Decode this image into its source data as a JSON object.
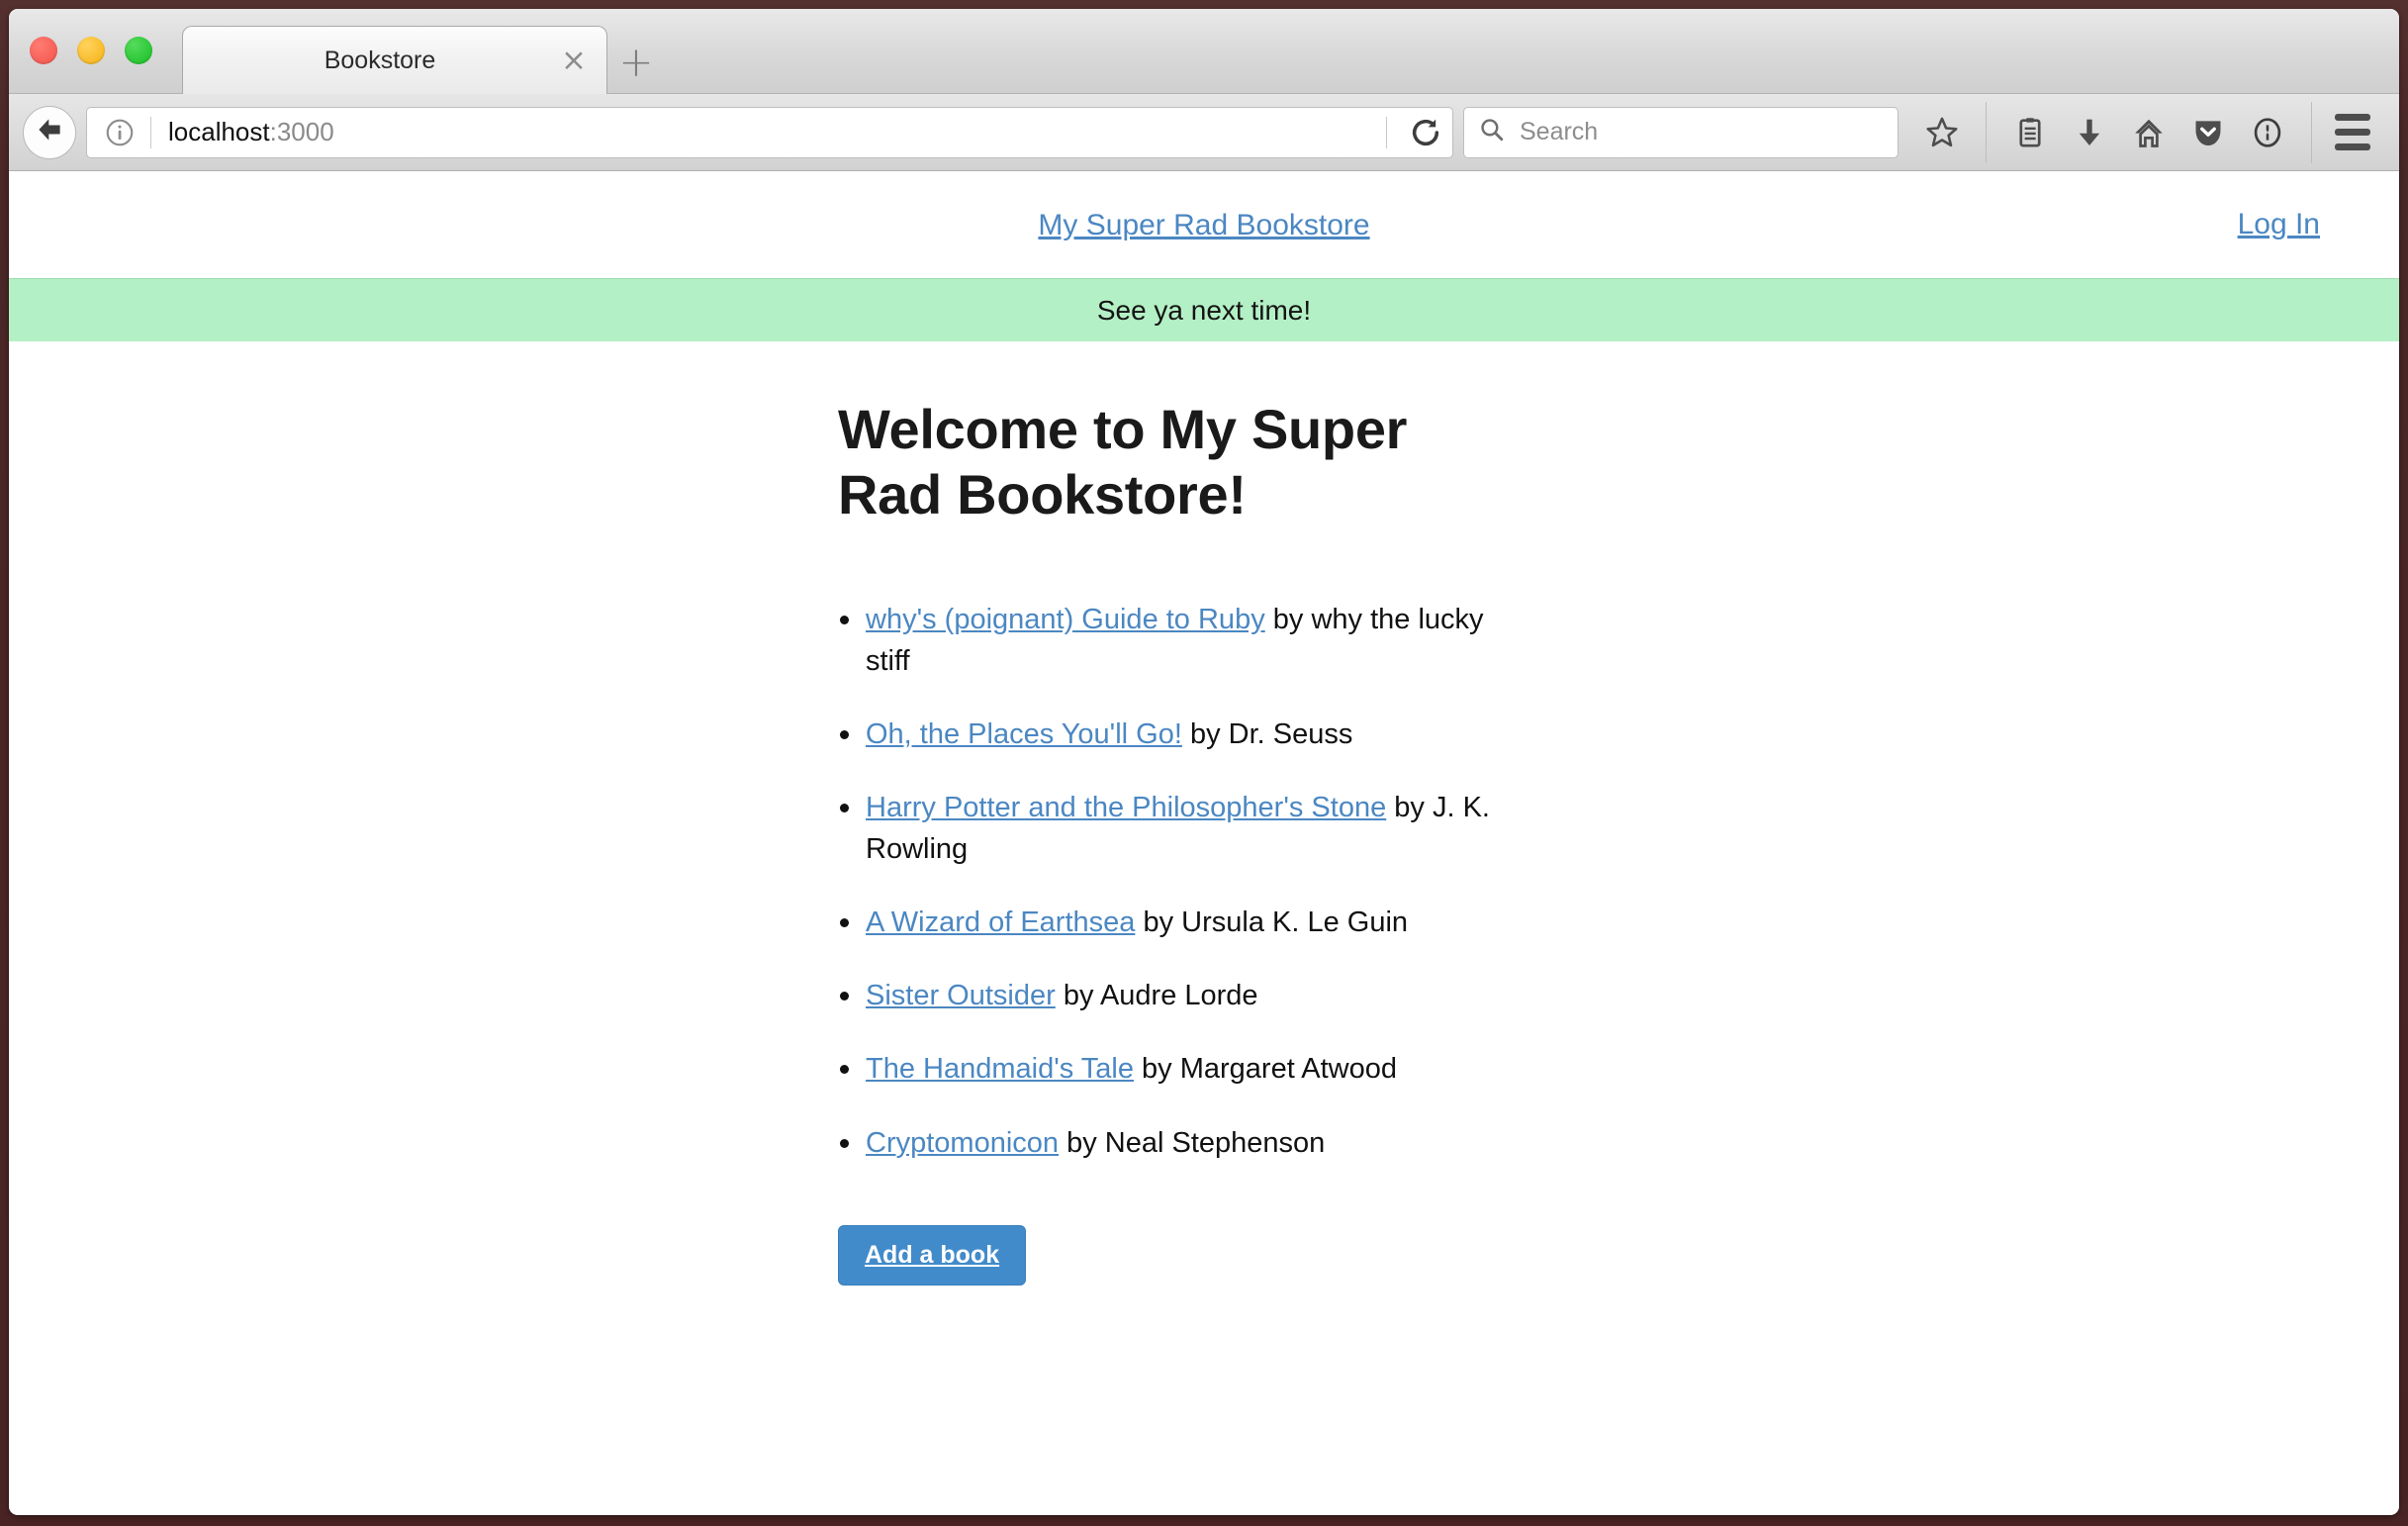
{
  "browser": {
    "window_controls": [
      "close",
      "minimize",
      "zoom"
    ],
    "tab": {
      "title": "Bookstore",
      "close_label": "×"
    },
    "new_tab_label": "+",
    "url": {
      "host": "localhost",
      "port": ":3000"
    },
    "search": {
      "placeholder": "Search",
      "value": ""
    },
    "toolbar_icons": [
      "back-icon",
      "identity-info-icon",
      "reload-icon",
      "search-icon",
      "bookmark-star-icon",
      "reading-list-icon",
      "downloads-icon",
      "home-icon",
      "pocket-icon",
      "onepassword-icon",
      "menu-hamburger-icon"
    ]
  },
  "page": {
    "header": {
      "brand": "My Super Rad Bookstore",
      "login_label": "Log In"
    },
    "flash": {
      "message": "See ya next time!",
      "background": "#b4f0c5"
    },
    "title": "Welcome to My Super Rad Bookstore!",
    "books": [
      {
        "title": "why's (poignant) Guide to Ruby",
        "byline": " by why the lucky stiff"
      },
      {
        "title": "Oh, the Places You'll Go!",
        "byline": " by Dr. Seuss"
      },
      {
        "title": "Harry Potter and the Philosopher's Stone",
        "byline": " by J. K. Rowling"
      },
      {
        "title": "A Wizard of Earthsea",
        "byline": " by Ursula K. Le Guin"
      },
      {
        "title": "Sister Outsider",
        "byline": " by Audre Lorde"
      },
      {
        "title": "The Handmaid's Tale",
        "byline": " by Margaret Atwood"
      },
      {
        "title": "Cryptomonicon",
        "byline": " by Neal Stephenson"
      }
    ],
    "add_book_label": "Add a book",
    "colors": {
      "link": "#4b87c2",
      "button": "#428bca",
      "flash": "#b4f0c5",
      "window_frame": "#4a2424"
    }
  }
}
